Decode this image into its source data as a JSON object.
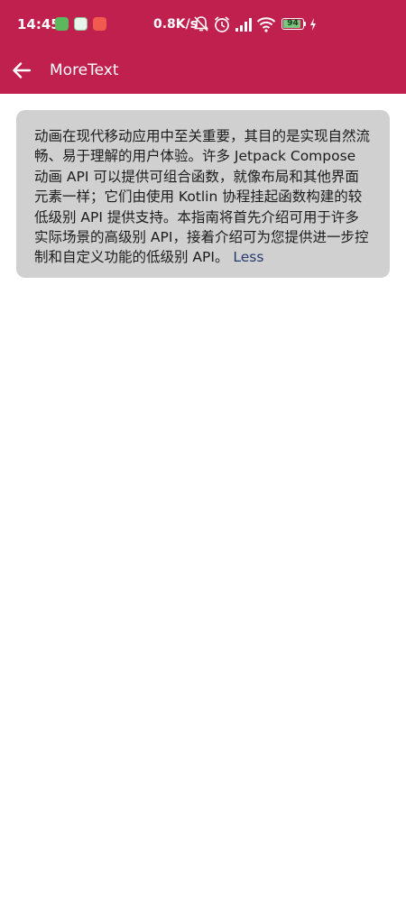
{
  "status_bar": {
    "time": "14:45",
    "net_speed": "0.8K/s",
    "battery": "94",
    "icons": [
      "notification-app-icon",
      "translate-app-icon",
      "video-app-icon",
      "mute-icon",
      "alarm-icon",
      "signal-icon",
      "wifi-icon",
      "battery-icon",
      "charging-icon"
    ]
  },
  "app_bar": {
    "title": "MoreText",
    "back_icon": "arrow-back-icon"
  },
  "content": {
    "paragraph": "动画在现代移动应用中至关重要，其目的是实现自然流畅、易于理解的用户体验。许多 Jetpack Compose 动画 API 可以提供可组合函数，就像布局和其他界面元素一样；它们由使用 Kotlin 协程挂起函数构建的较低级别 API 提供支持。本指南将首先介绍可用于许多实际场景的高级别 API，接着介绍可为您提供进一步控制和自定义功能的低级别 API。",
    "less_label": "Less"
  },
  "colors": {
    "accent": "#c0204e",
    "card_background": "#d0d0d0",
    "link": "#243a6e"
  }
}
